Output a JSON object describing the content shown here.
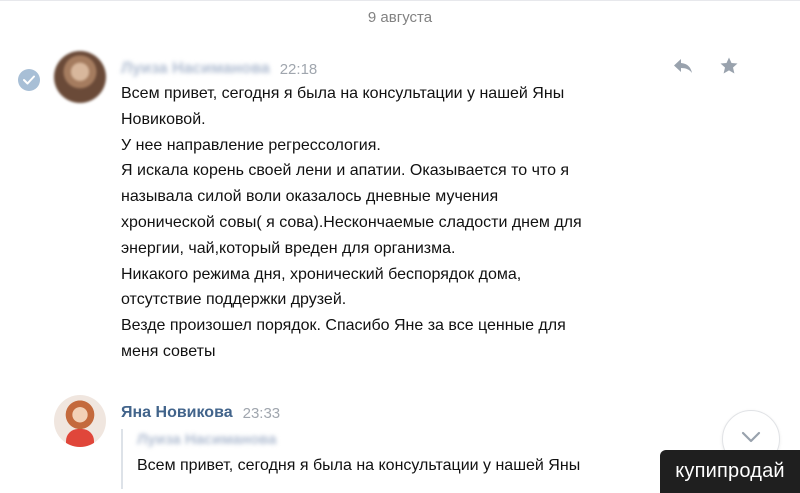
{
  "date_separator": "9 августа",
  "messages": [
    {
      "author": "Луиза Насиманова",
      "time": "22:18",
      "lines": [
        "Всем привет, сегодня я была на консультации у нашей Яны",
        "Новиковой.",
        "У нее направление регрессология.",
        "Я искала корень своей лени и апатии. Оказывается то что я",
        "называла силой воли оказалось дневные мучения",
        "хронической совы( я сова).Нескончаемые сладости днем для",
        "энергии, чай,который вреден для организма.",
        "Никакого режима дня, хронический беспорядок дома,",
        "отсутствие поддержки друзей.",
        "Везде произошел порядок. Спасибо Яне за все ценные для",
        "меня советы"
      ]
    },
    {
      "author": "Яна Новикова",
      "time": "23:33",
      "quote": {
        "author": "Луиза Насиманова",
        "text": "Всем привет, сегодня я была на консультации у нашей Яны"
      }
    }
  ],
  "watermark": "купипродай",
  "icons": {
    "selected": "check-circle-icon",
    "reply": "reply-arrow-icon",
    "favorite": "star-icon",
    "scroll": "chevron-down-icon"
  },
  "colors": {
    "author_name": "#42648b",
    "time": "#a0a6ae",
    "date_separator": "#828282",
    "action_icon": "#99a2ad"
  }
}
